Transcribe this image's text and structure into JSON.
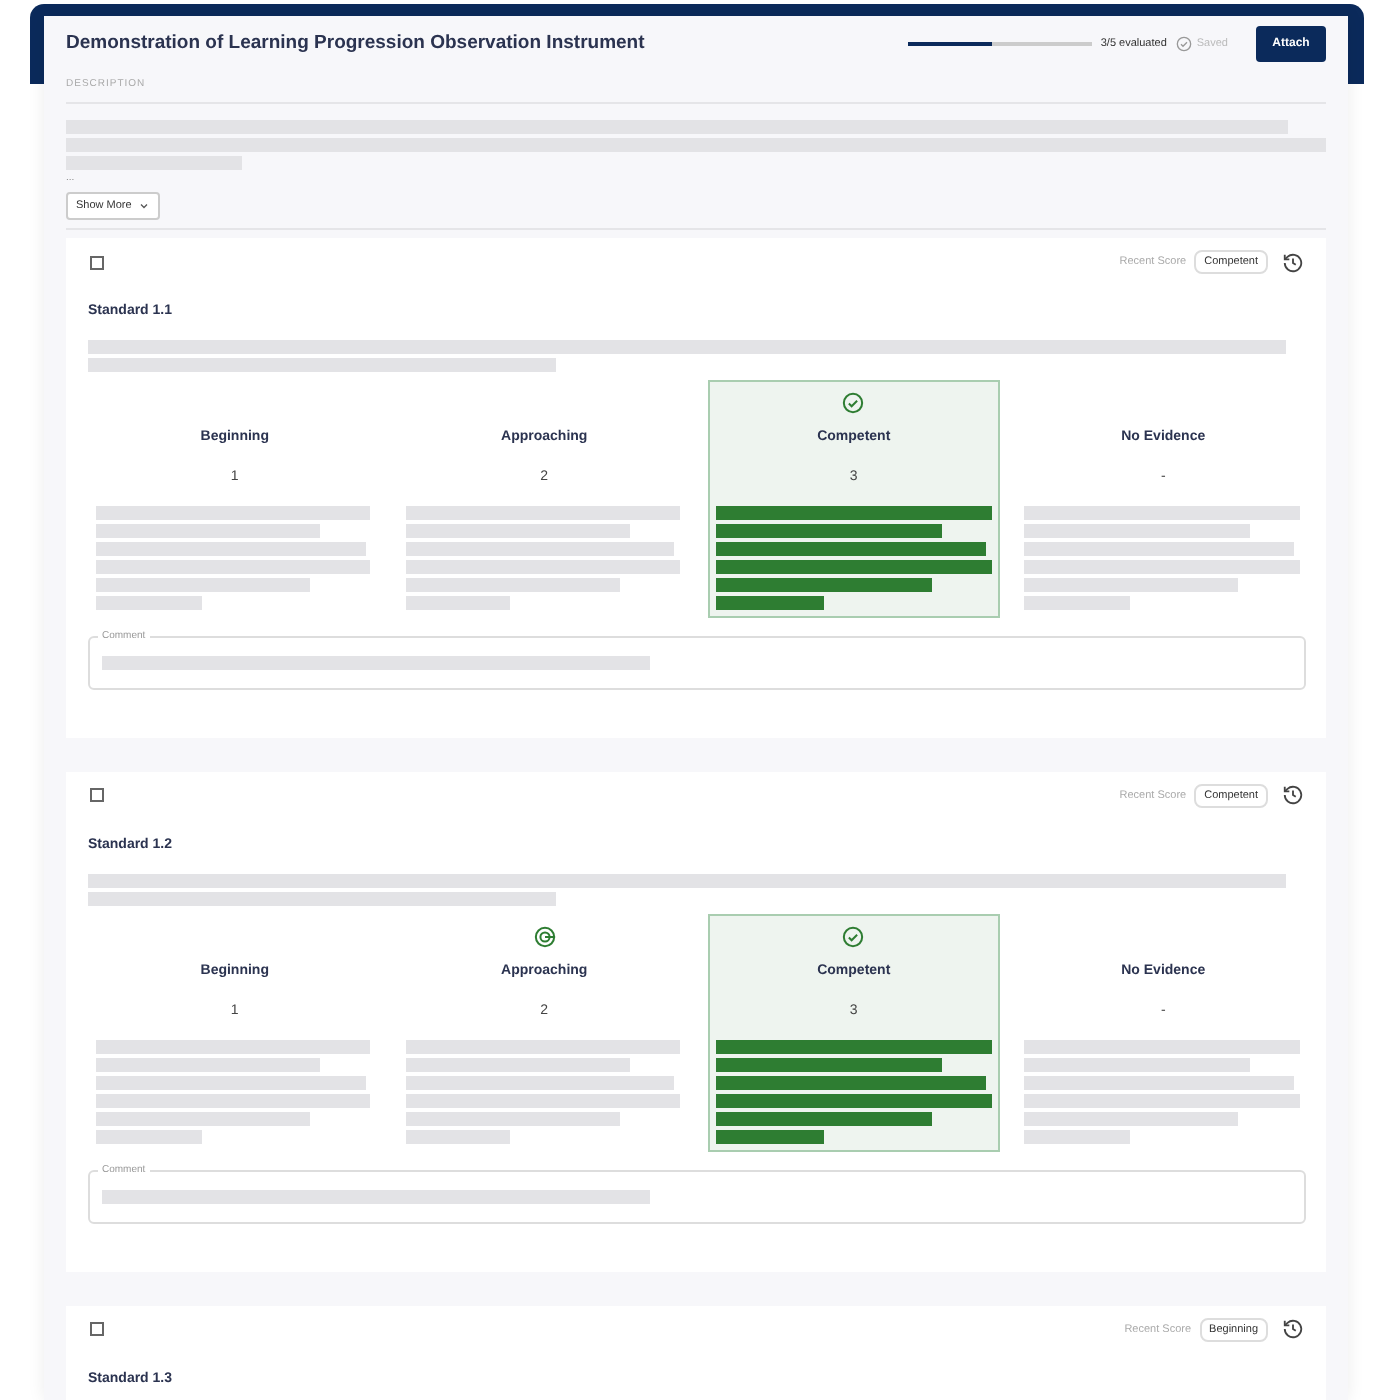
{
  "header": {
    "title": "Demonstration of Learning Progression Observation Instrument",
    "progress": {
      "level": 0.45,
      "text": "3/5 evaluated"
    },
    "save_status": "Saved",
    "attach_button": "Attach"
  },
  "description": {
    "label": "DESCRIPTION",
    "ellipsis": "...",
    "show_more": "Show More"
  },
  "standards": [
    {
      "title": "Standard 1.1",
      "checked": false,
      "recent_score_label": "Recent Score",
      "recent_score": "Competent",
      "comment_label": "Comment",
      "levels": [
        {
          "label": "Beginning",
          "score": "1",
          "selected": false,
          "previous": false
        },
        {
          "label": "Approaching",
          "score": "2",
          "selected": false,
          "previous": false
        },
        {
          "label": "Competent",
          "score": "3",
          "selected": true,
          "previous": false
        },
        {
          "label": "No Evidence",
          "score": "-",
          "selected": false,
          "previous": false
        }
      ]
    },
    {
      "title": "Standard 1.2",
      "checked": false,
      "recent_score_label": "Recent Score",
      "recent_score": "Competent",
      "comment_label": "Comment",
      "levels": [
        {
          "label": "Beginning",
          "score": "1",
          "selected": false,
          "previous": false
        },
        {
          "label": "Approaching",
          "score": "2",
          "selected": false,
          "previous": true
        },
        {
          "label": "Competent",
          "score": "3",
          "selected": true,
          "previous": false
        },
        {
          "label": "No Evidence",
          "score": "-",
          "selected": false,
          "previous": false
        }
      ]
    },
    {
      "title": "Standard 1.3",
      "checked": false,
      "recent_score_label": "Recent Score",
      "recent_score": "Beginning"
    }
  ]
}
